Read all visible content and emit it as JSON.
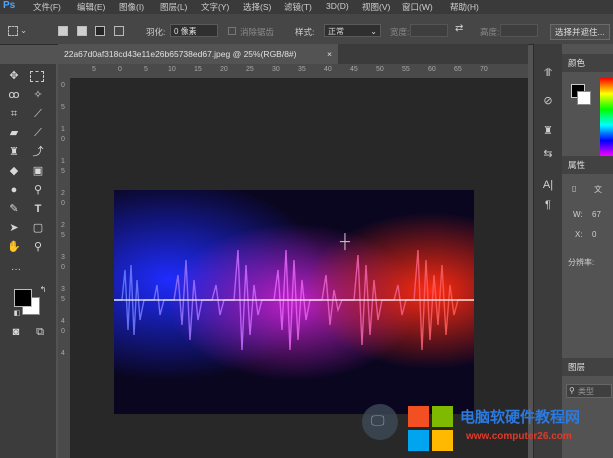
{
  "app": {
    "logo": "Ps"
  },
  "menu": [
    "文件(F)",
    "编辑(E)",
    "图像(I)",
    "图层(L)",
    "文字(Y)",
    "选择(S)",
    "滤镜(T)",
    "3D(D)",
    "视图(V)",
    "窗口(W)",
    "帮助(H)"
  ],
  "options": {
    "feather_label": "羽化:",
    "feather_value": "0 像素",
    "antialias_label": "消除锯齿",
    "style_label": "样式:",
    "style_value": "正常",
    "width_label": "宽度:",
    "height_label": "高度:",
    "select_mask_button": "选择并遮住..."
  },
  "document": {
    "tab_title": "22a67d0af318cd43e11e26b65738ed67.jpeg @ 25%(RGB/8#)",
    "close_glyph": "×"
  },
  "ruler_top_numbers": [
    "5",
    "0",
    "5",
    "10",
    "15",
    "20",
    "25",
    "30",
    "35",
    "40",
    "45",
    "50",
    "55",
    "60",
    "65",
    "70"
  ],
  "ruler_left_numbers": [
    "0",
    "5",
    "1",
    "0",
    "1",
    "5",
    "2",
    "0",
    "2",
    "5",
    "3",
    "0",
    "3",
    "5",
    "4",
    "0",
    "4",
    "5"
  ],
  "panels": {
    "color": {
      "title": "颜色"
    },
    "properties": {
      "title": "属性",
      "doc_label": "文",
      "w_label": "W:",
      "w_value": "67",
      "x_label": "X:",
      "x_value": "0",
      "resolution_label": "分辨率:"
    },
    "layers": {
      "title": "图层",
      "search_placeholder": "类型"
    }
  },
  "watermark": {
    "site_name": "电脑软硬件教程网",
    "url": "www.computer26.com"
  },
  "colors": {
    "foreground": "#000000",
    "background": "#ffffff",
    "accent": "#4ea5ff"
  }
}
